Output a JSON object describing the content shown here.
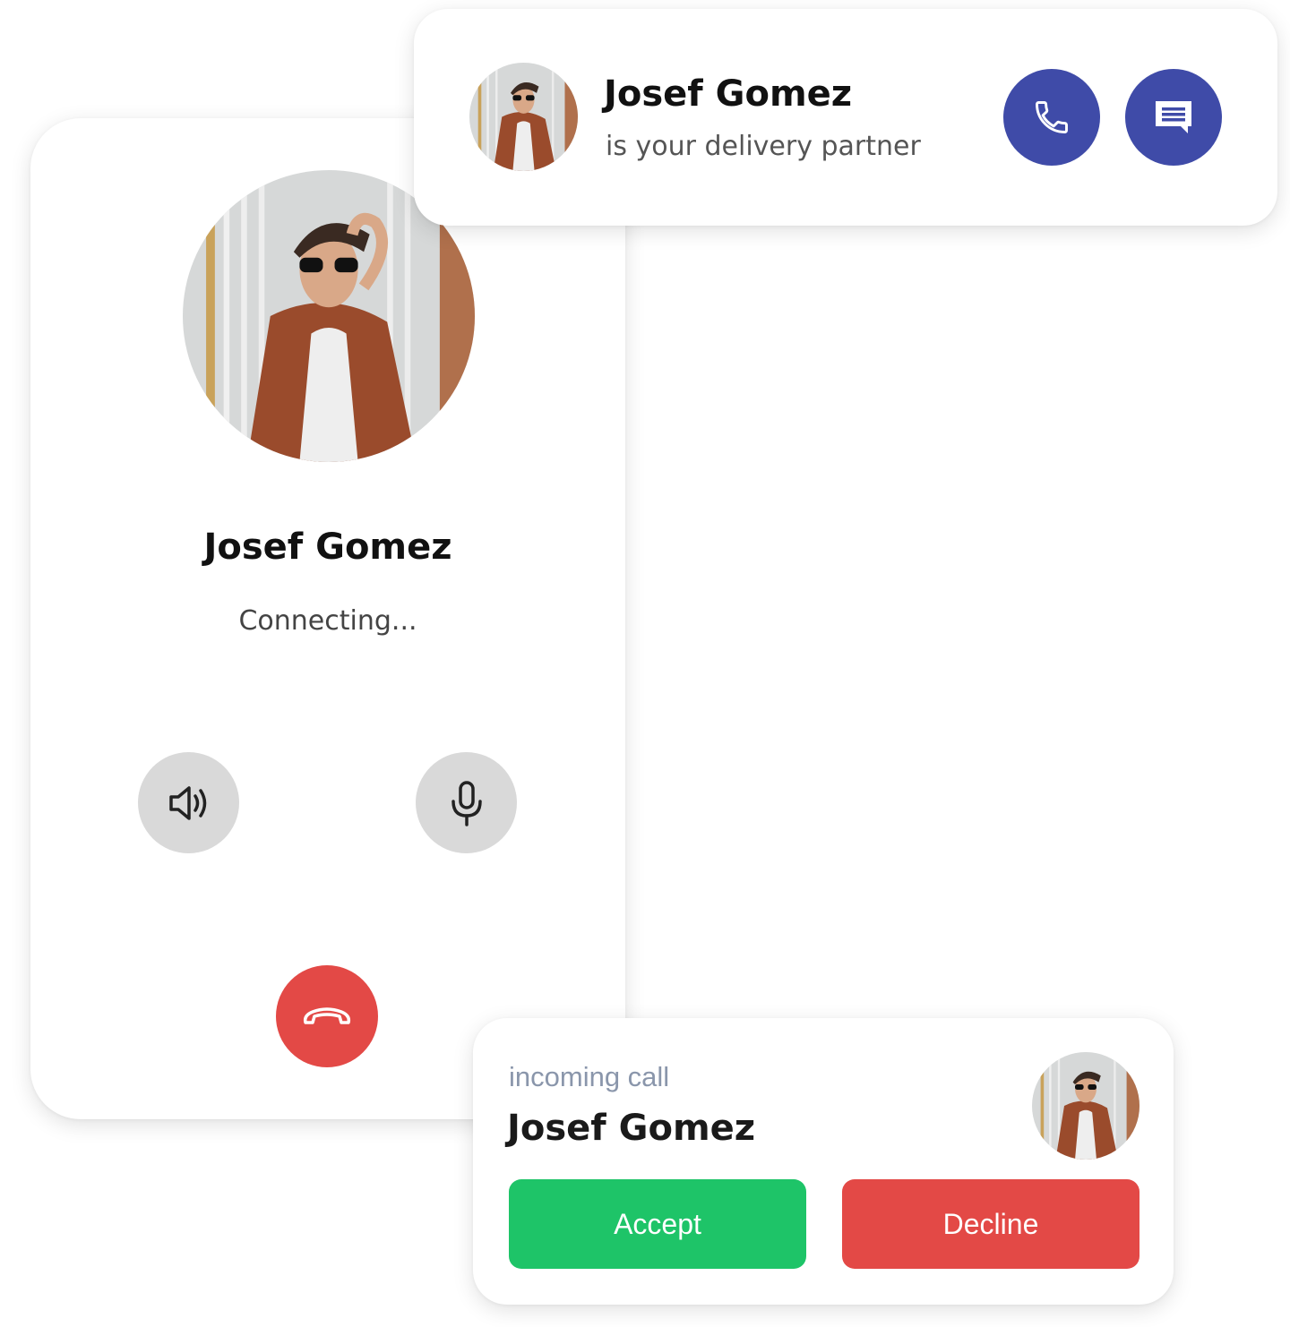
{
  "call_screen": {
    "contact_name": "Josef Gomez",
    "status": "Connecting...",
    "icons": {
      "speaker": "speaker-icon",
      "microphone": "microphone-icon",
      "end_call": "hang-up-icon"
    },
    "colors": {
      "end_call": "#e34946",
      "control_bg": "#d9d9d9"
    }
  },
  "notification": {
    "contact_name": "Josef Gomez",
    "subtitle": "is your delivery partner",
    "icons": {
      "call": "phone-icon",
      "message": "message-icon"
    },
    "colors": {
      "action": "#3f4ba8"
    }
  },
  "incoming_call": {
    "label": "incoming call",
    "contact_name": "Josef Gomez",
    "accept_label": "Accept",
    "decline_label": "Decline",
    "colors": {
      "accept": "#1ec468",
      "decline": "#e34946"
    }
  }
}
